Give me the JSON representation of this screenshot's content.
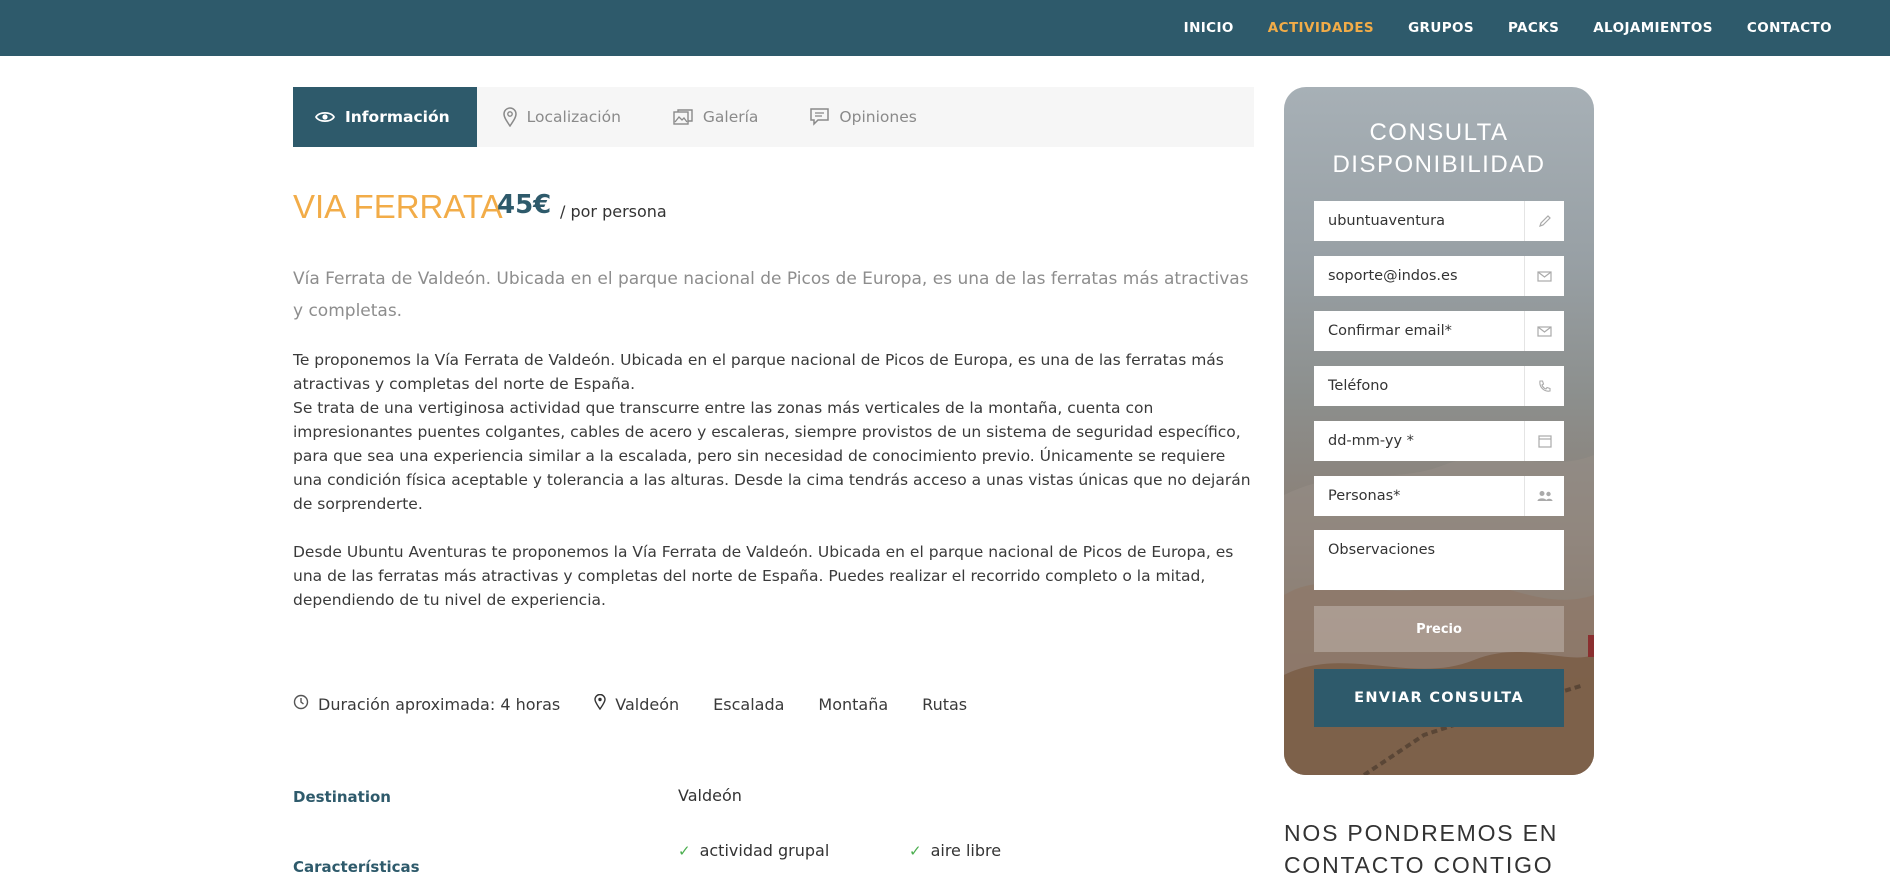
{
  "nav": {
    "items": [
      "INICIO",
      "ACTIVIDADES",
      "GRUPOS",
      "PACKS",
      "ALOJAMIENTOS",
      "CONTACTO"
    ],
    "active": "ACTIVIDADES",
    "accent_color": "#f2ac48",
    "bar_color": "#2e5a6b"
  },
  "tabs": [
    {
      "label": "Información",
      "icon": "eye-icon",
      "active": true
    },
    {
      "label": "Localización",
      "icon": "map-pin-icon",
      "active": false
    },
    {
      "label": "Galería",
      "icon": "gallery-icon",
      "active": false
    },
    {
      "label": "Opiniones",
      "icon": "comment-icon",
      "active": false
    }
  ],
  "activity": {
    "title": "VIA FERRATA",
    "price": "45€",
    "price_unit": "/ por persona",
    "lead": "Vía Ferrata de Valdeón. Ubicada en el parque nacional de Picos de Europa, es una de las ferratas más atractivas y completas.",
    "paragraph1": "Te proponemos la Vía Ferrata de Valdeón. Ubicada en el parque nacional de Picos de Europa, es una de las ferratas más atractivas y completas del norte de España. Se trata de una vertiginosa actividad que transcurre entre las zonas más verticales de la montaña, cuenta con impresionantes puentes colgantes, cables de acero y escaleras, siempre provistos de un sistema de seguridad específico, para que sea una experiencia similar a la escalada, pero sin necesidad de conocimiento previo. Únicamente se requiere una condición física aceptable y tolerancia a las alturas. Desde la cima tendrás acceso a unas vistas únicas que no dejarán de sorprenderte.",
    "paragraph1a": "Te proponemos la Vía Ferrata de Valdeón. Ubicada en el parque nacional de Picos de Europa, es una de las ferratas más atractivas y completas del norte de España.",
    "paragraph1b": "Se trata de una vertiginosa actividad que transcurre entre las zonas más verticales de la montaña, cuenta con impresionantes puentes colgantes, cables de acero y escaleras, siempre provistos de un sistema de seguridad específico, para que sea una experiencia similar a la escalada, pero sin necesidad de conocimiento previo. Únicamente se requiere una condición física aceptable y tolerancia a las alturas. Desde la cima tendrás acceso a unas vistas únicas que no dejarán de sorprenderte.",
    "paragraph2": "Desde Ubuntu Aventuras te proponemos la Vía Ferrata de Valdeón. Ubicada en el parque nacional de Picos de Europa, es una de las ferratas más atractivas y completas del norte de España. Puedes realizar el recorrido completo o la mitad, dependiendo de tu nivel de experiencia."
  },
  "meta": {
    "duration": "Duración aproximada: 4 horas",
    "location": "Valdeón",
    "tags": [
      "Escalada",
      "Montaña",
      "Rutas"
    ]
  },
  "details": {
    "destination_label": "Destination",
    "destination_value": "Valdeón",
    "features_label": "Características",
    "features": [
      "actividad grupal",
      "aire libre"
    ]
  },
  "form": {
    "title_line1": "CONSULTA",
    "title_line2": "DISPONIBILIDAD",
    "name_value": "ubuntuaventura",
    "email_value": "soporte@indos.es",
    "confirm_email_placeholder": "Confirmar email*",
    "phone_placeholder": "Teléfono",
    "date_placeholder": "dd-mm-yy *",
    "persons_placeholder": "Personas*",
    "notes_placeholder": "Observaciones",
    "price_button": "Precio",
    "send_button": "ENVIAR CONSULTA"
  },
  "contact": {
    "title": "NOS PONDREMOS EN CONTACTO CONTIGO"
  }
}
